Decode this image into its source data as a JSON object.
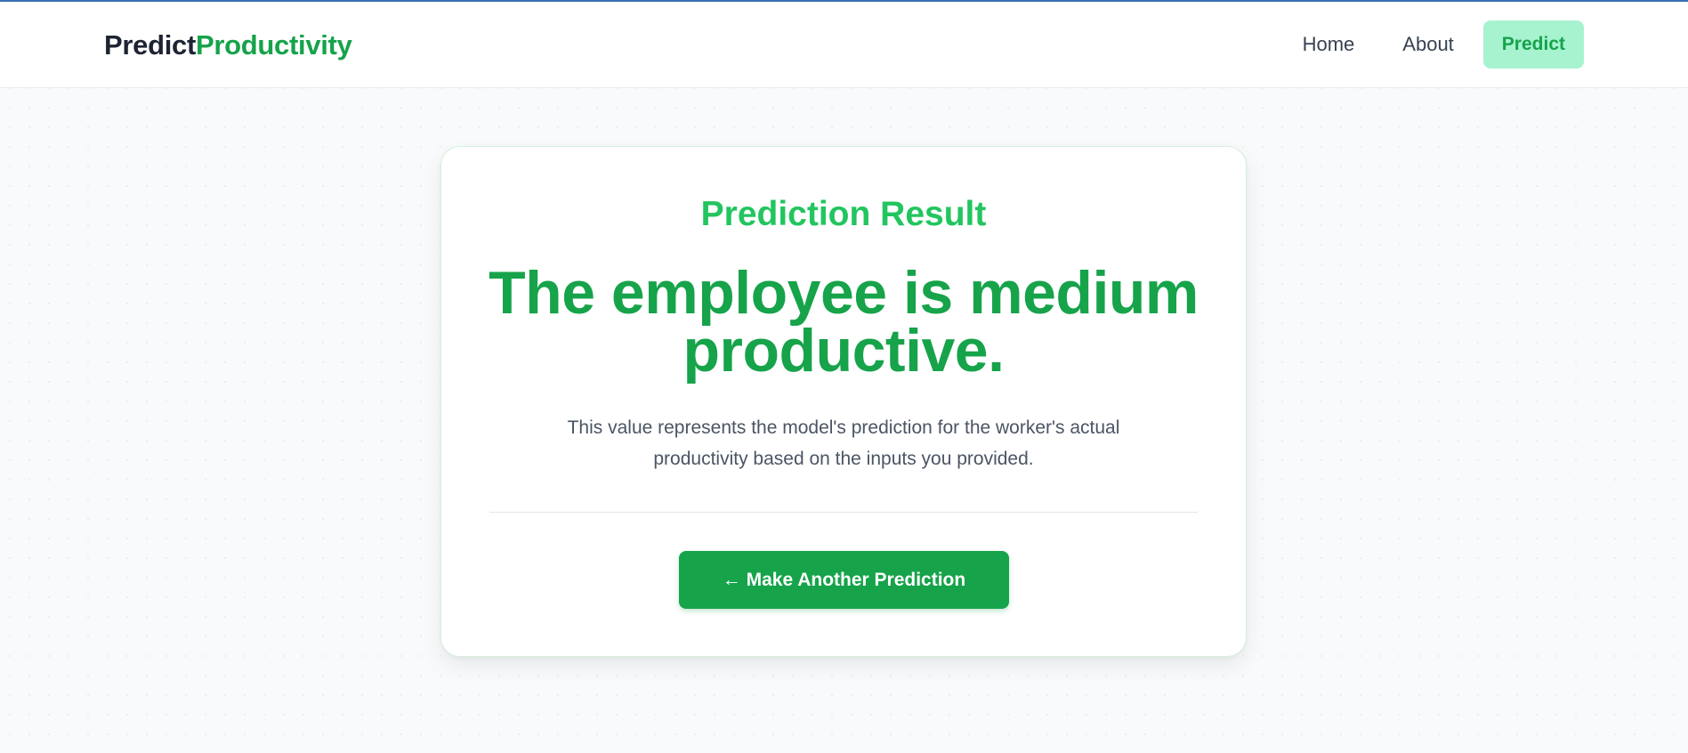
{
  "header": {
    "logo_part1": "Predict",
    "logo_part2": "Productivity",
    "nav": {
      "home": "Home",
      "about": "About",
      "predict": "Predict"
    }
  },
  "result_card": {
    "heading": "Prediction Result",
    "result_text": "The employee is medium productive.",
    "description": "This value represents the model's prediction for the worker's actual productivity based on the inputs you provided.",
    "button_arrow": "←",
    "button_label": "Make Another Prediction"
  },
  "colors": {
    "brand_green": "#16a34a",
    "heading_green": "#22c55e",
    "active_nav_bg": "#a7f3d0",
    "text_dark": "#1e2433"
  }
}
